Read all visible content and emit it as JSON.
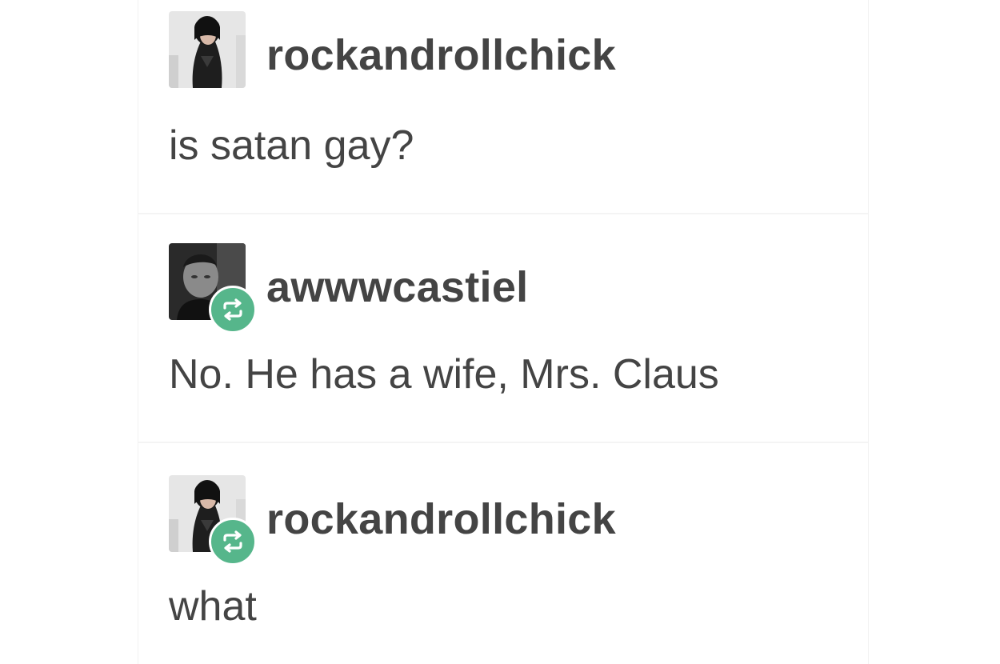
{
  "thread": {
    "posts": [
      {
        "username": "rockandrollchick",
        "avatar_icon": "user-avatar-woman",
        "reblog": false,
        "text": "is satan gay?"
      },
      {
        "username": "awwwcastiel",
        "avatar_icon": "user-avatar-man",
        "reblog": true,
        "text": "No. He has a wife, Mrs. Claus"
      },
      {
        "username": "rockandrollchick",
        "avatar_icon": "user-avatar-woman",
        "reblog": true,
        "text": "what"
      }
    ]
  },
  "colors": {
    "text": "#444444",
    "reblog_badge": "#56b68b",
    "background": "#ffffff"
  },
  "icons": {
    "reblog": "reblog-icon"
  }
}
